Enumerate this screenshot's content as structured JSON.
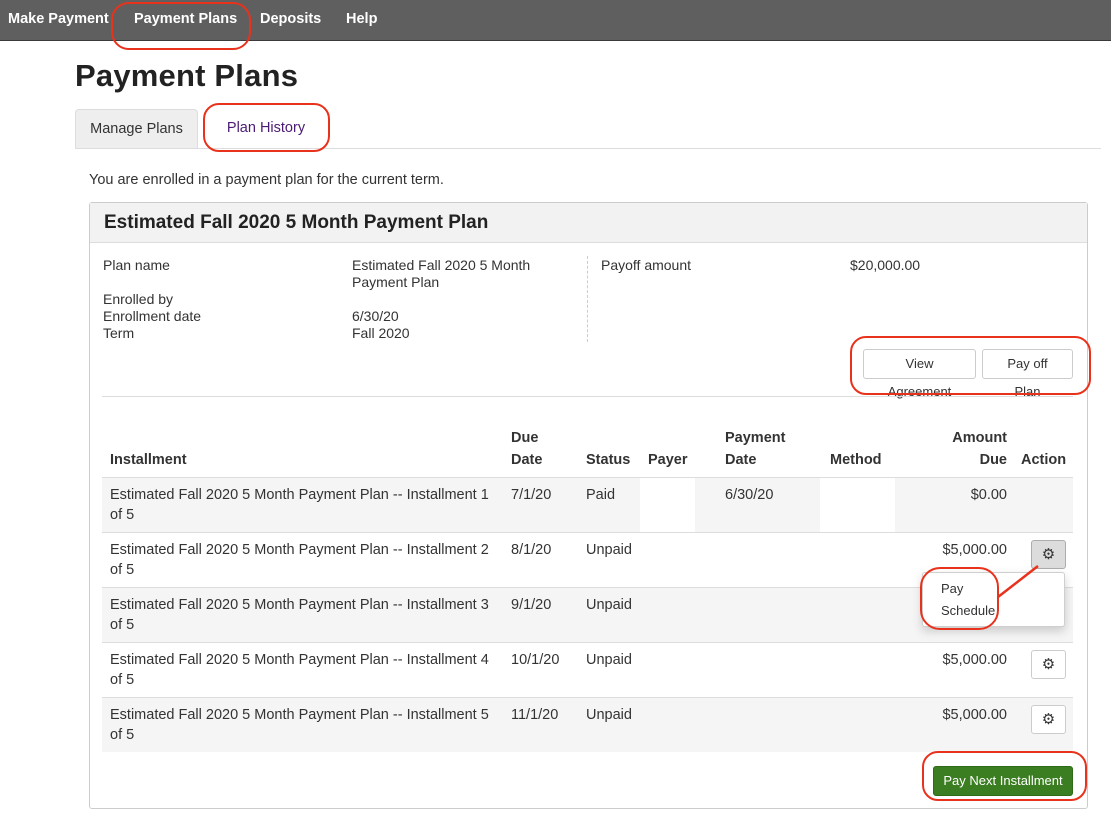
{
  "nav": {
    "items": [
      {
        "label": "Make Payment"
      },
      {
        "label": "Payment Plans"
      },
      {
        "label": "Deposits"
      },
      {
        "label": "Help"
      }
    ]
  },
  "page": {
    "title": "Payment Plans",
    "tabs": [
      {
        "label": "Manage Plans"
      },
      {
        "label": "Plan History"
      }
    ],
    "notice": "You are enrolled in a payment plan for the current term."
  },
  "plan": {
    "title": "Estimated Fall 2020 5 Month Payment Plan",
    "fields": {
      "plan_name_label": "Plan name",
      "plan_name_value_line1": "Estimated Fall 2020 5 Month",
      "plan_name_value_line2": "Payment Plan",
      "enrolled_by_label": "Enrolled by",
      "enrollment_date_label": "Enrollment date",
      "enrollment_date_value": "6/30/20",
      "term_label": "Term",
      "term_value": "Fall 2020",
      "payoff_amount_label": "Payoff amount",
      "payoff_amount_value": "$20,000.00"
    },
    "buttons": {
      "view_agreement": "View Agreement",
      "pay_off_plan": "Pay off Plan",
      "pay_next_installment": "Pay Next Installment"
    },
    "table": {
      "headers": {
        "installment": "Installment",
        "due_date_1": "Due",
        "due_date_2": "Date",
        "status": "Status",
        "payer": "Payer",
        "payment_date_1": "Payment",
        "payment_date_2": "Date",
        "method": "Method",
        "amount_due_1": "Amount",
        "amount_due_2": "Due",
        "action": "Action"
      },
      "rows": [
        {
          "name_line1": "Estimated Fall 2020 5 Month Payment Plan -- Installment 1",
          "name_line2": "of 5",
          "due_date": "7/1/20",
          "status": "Paid",
          "payer": "",
          "payment_date": "6/30/20",
          "method": "",
          "amount_due": "$0.00"
        },
        {
          "name_line1": "Estimated Fall 2020 5 Month Payment Plan -- Installment 2",
          "name_line2": "of 5",
          "due_date": "8/1/20",
          "status": "Unpaid",
          "payer": "",
          "payment_date": "",
          "method": "",
          "amount_due": "$5,000.00"
        },
        {
          "name_line1": "Estimated Fall 2020 5 Month Payment Plan -- Installment 3",
          "name_line2": "of 5",
          "due_date": "9/1/20",
          "status": "Unpaid",
          "payer": "",
          "payment_date": "",
          "method": "",
          "amount_due": ""
        },
        {
          "name_line1": "Estimated Fall 2020 5 Month Payment Plan -- Installment 4",
          "name_line2": "of 5",
          "due_date": "10/1/20",
          "status": "Unpaid",
          "payer": "",
          "payment_date": "",
          "method": "",
          "amount_due": "$5,000.00"
        },
        {
          "name_line1": "Estimated Fall 2020 5 Month Payment Plan -- Installment 5",
          "name_line2": "of 5",
          "due_date": "11/1/20",
          "status": "Unpaid",
          "payer": "",
          "payment_date": "",
          "method": "",
          "amount_due": "$5,000.00"
        }
      ]
    },
    "action_menu": {
      "pay": "Pay",
      "schedule": "Schedule"
    }
  },
  "icons": {
    "action": "gear-icon"
  },
  "colors": {
    "nav_bg": "#5f5f5f",
    "primary_green": "#3b7d21",
    "annotation_red": "#e8321c",
    "tab_link": "#4b1b74"
  }
}
